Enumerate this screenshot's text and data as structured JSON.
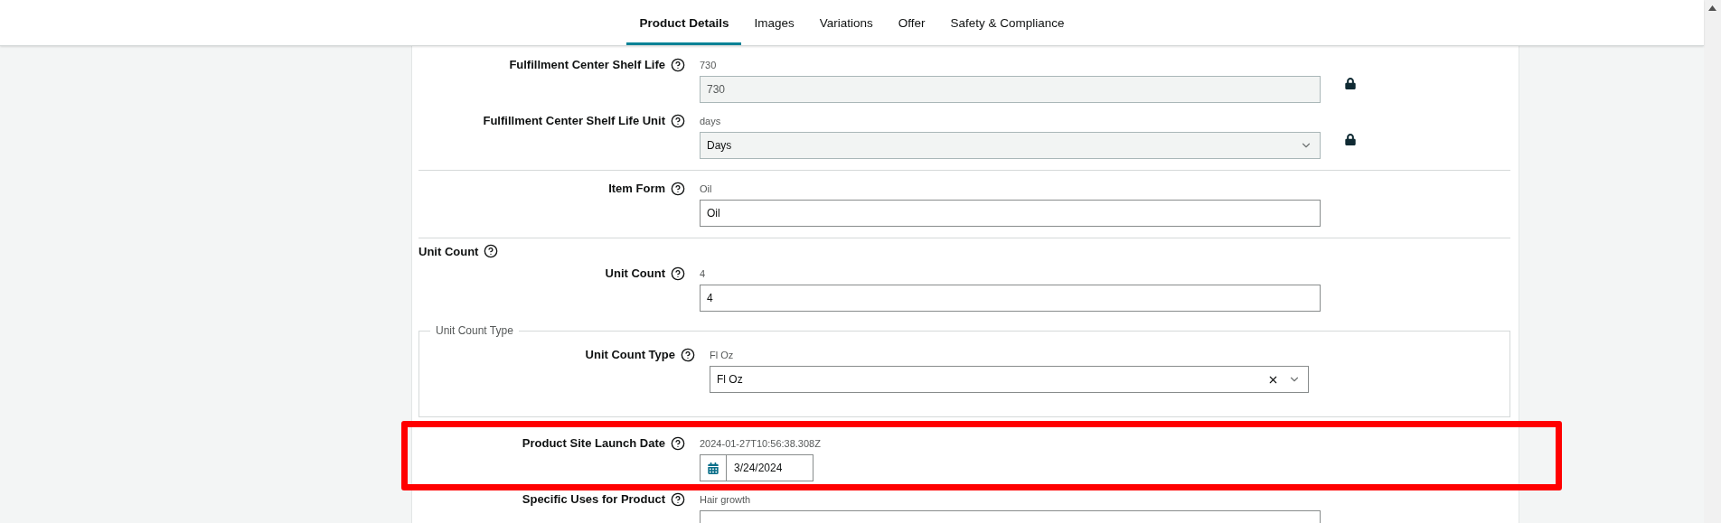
{
  "tabs": [
    {
      "label": "Product Details",
      "selected": true
    },
    {
      "label": "Images",
      "selected": false
    },
    {
      "label": "Variations",
      "selected": false
    },
    {
      "label": "Offer",
      "selected": false
    },
    {
      "label": "Safety & Compliance",
      "selected": false
    }
  ],
  "items": [
    {
      "kind": "text",
      "label": "Fulfillment Center Shelf Life",
      "hint": "730",
      "value": "730",
      "locked": true
    },
    {
      "kind": "select",
      "label": "Fulfillment Center Shelf Life Unit",
      "hint": "days",
      "value": "Days",
      "locked": true
    },
    {
      "kind": "divider"
    },
    {
      "kind": "text",
      "label": "Item Form",
      "hint": "Oil",
      "value": "Oil"
    },
    {
      "kind": "divider"
    },
    {
      "kind": "heading",
      "text": "Unit Count"
    },
    {
      "kind": "text",
      "label": "Unit Count",
      "hint": "4",
      "value": "4"
    },
    {
      "kind": "group",
      "legend": "Unit Count Type",
      "fields": [
        {
          "kind": "select",
          "label": "Unit Count Type",
          "hint": "Fl Oz",
          "value": "Fl Oz",
          "clearable": true
        }
      ]
    },
    {
      "kind": "divider"
    },
    {
      "kind": "date",
      "label": "Product Site Launch Date",
      "hint": "2024-01-27T10:56:38.308Z",
      "value": "3/24/2024",
      "highlighted": true
    },
    {
      "kind": "text",
      "label": "Specific Uses for Product",
      "hint": "Hair growth"
    }
  ]
}
